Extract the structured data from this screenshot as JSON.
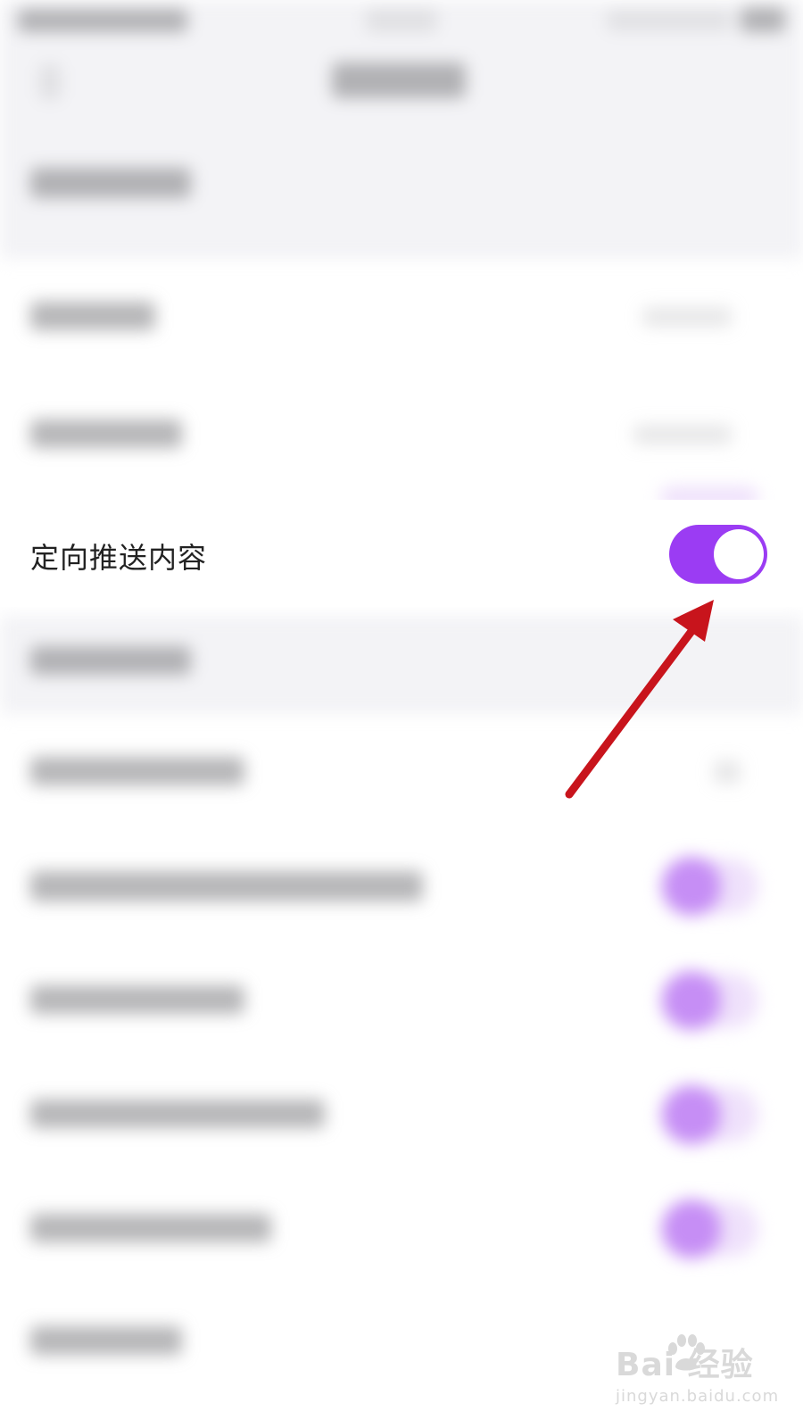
{
  "setting_row": {
    "label": "定向推送内容",
    "toggle_state": "on"
  },
  "colors": {
    "accent": "#9b3cf3",
    "arrow": "#c8141c",
    "watermark": "#d9d9d9"
  },
  "watermark": {
    "brand": "Bai  经验",
    "url": "jingyan.baidu.com",
    "icon": "baidu-paw-icon"
  },
  "annotation": {
    "icon": "red-arrow-icon"
  }
}
